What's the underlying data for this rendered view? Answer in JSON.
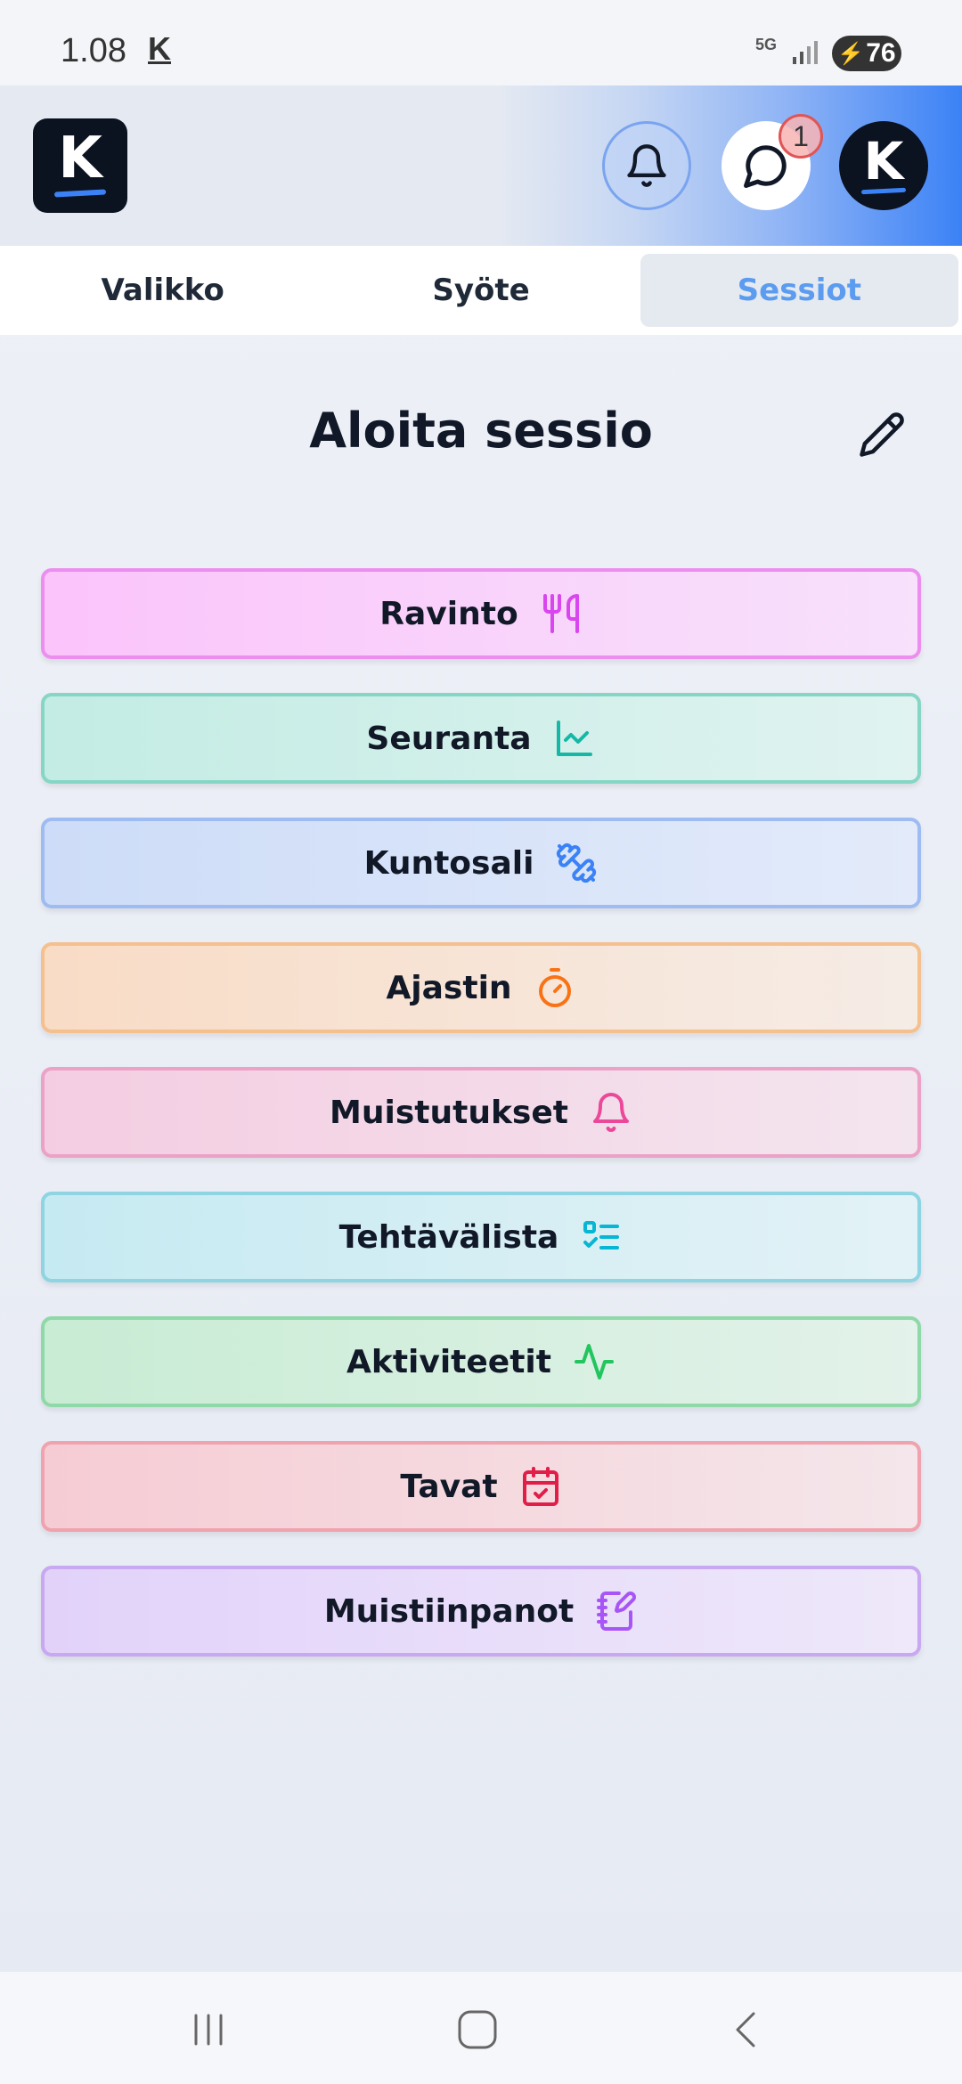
{
  "status_bar": {
    "time": "1.08",
    "app_indicator": "K",
    "network": "5G",
    "battery": "76"
  },
  "header": {
    "logo_letter": "K",
    "notifications_icon": "bell-icon",
    "messages_icon": "chat-icon",
    "messages_badge": "1",
    "avatar_letter": "K",
    "accent": "#3b82f6"
  },
  "tabs": [
    {
      "label": "Valikko",
      "active": false
    },
    {
      "label": "Syöte",
      "active": false
    },
    {
      "label": "Sessiot",
      "active": true
    }
  ],
  "main": {
    "title": "Aloita sessio",
    "edit_icon": "pencil-icon",
    "sessions": [
      {
        "label": "Ravinto",
        "icon": "utensils-icon",
        "color": "#d946ef"
      },
      {
        "label": "Seuranta",
        "icon": "chart-line-icon",
        "color": "#14b8a6"
      },
      {
        "label": "Kuntosali",
        "icon": "dumbbell-icon",
        "color": "#3b82f6"
      },
      {
        "label": "Ajastin",
        "icon": "timer-icon",
        "color": "#f97316"
      },
      {
        "label": "Muistutukset",
        "icon": "bell-icon",
        "color": "#ec4899"
      },
      {
        "label": "Tehtävälista",
        "icon": "list-checks-icon",
        "color": "#06b6d4"
      },
      {
        "label": "Aktiviteetit",
        "icon": "activity-icon",
        "color": "#22c55e"
      },
      {
        "label": "Tavat",
        "icon": "calendar-check-icon",
        "color": "#e11d48"
      },
      {
        "label": "Muistiinpanot",
        "icon": "notebook-pen-icon",
        "color": "#a855f7"
      }
    ]
  },
  "navbar": {
    "recents_icon": "recents-icon",
    "home_icon": "home-icon",
    "back_icon": "back-icon"
  }
}
